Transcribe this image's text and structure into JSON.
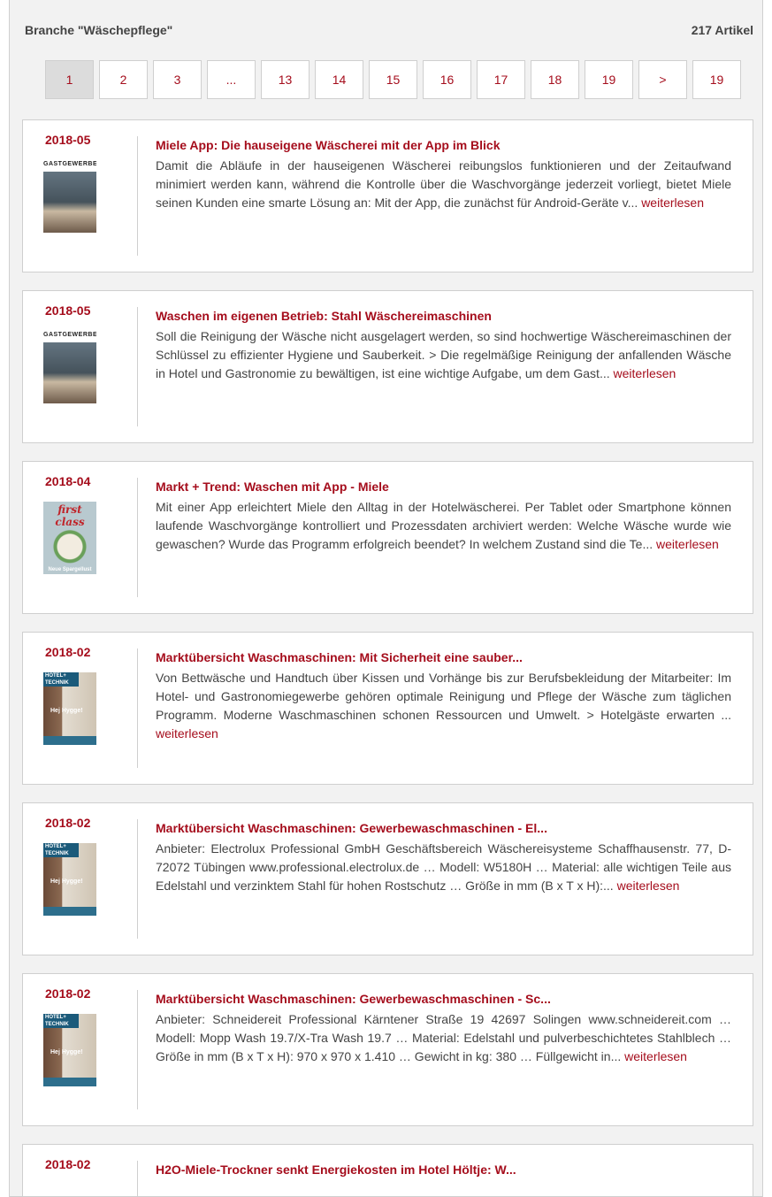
{
  "header": {
    "title": "Branche \"Wäschepflege\"",
    "count": "217 Artikel"
  },
  "pagination": {
    "pages": [
      "1",
      "2",
      "3",
      "...",
      "13",
      "14",
      "15",
      "16",
      "17",
      "18",
      "19",
      ">",
      "19"
    ],
    "active": "1"
  },
  "articles": [
    {
      "date": "2018-05",
      "cover": "Gastgewerbe Magazin cover",
      "title": "Miele App: Die hauseigene Wäscherei mit der App im Blick",
      "excerpt": "Damit die Abläufe in der hauseigenen Wäscherei reibungslos funktionieren und der Zeitaufwand minimiert werden kann, während die Kontrolle über die Waschvorgänge jederzeit vorliegt, bietet Miele seinen Kunden eine smarte Lösung an: Mit der App, die zunächst für Android-Geräte v...",
      "read_more": "weiterlesen"
    },
    {
      "date": "2018-05",
      "cover": "Gastgewerbe Magazin cover",
      "title": "Waschen im eigenen Betrieb: Stahl Wäschereimaschinen",
      "excerpt": "Soll die Reinigung der Wäsche nicht ausgelagert werden, so sind hochwertige Wäschereimaschinen der Schlüssel zu effizienter Hygiene und Sauberkeit. > Die regelmäßige Reinigung der anfallenden Wäsche in Hotel und Gastronomie zu bewältigen, ist eine wichtige Aufgabe, um dem Gast...",
      "read_more": "weiterlesen"
    },
    {
      "date": "2018-04",
      "cover": "first class magazine cover",
      "title": "Markt + Trend: Waschen mit App - Miele",
      "excerpt": "Mit einer App erleichtert Miele den Alltag in der Hotelwäscherei. Per Tablet oder Smartphone können laufende Waschvorgänge kontrolliert und Prozessdaten archiviert werden: Welche Wäsche wurde wie gewaschen? Wurde das Programm erfolgreich beendet? In welchem Zustand sind die Te...",
      "read_more": "weiterlesen"
    },
    {
      "date": "2018-02",
      "cover": "Hotel+Technik magazine cover",
      "title": "Marktübersicht Waschmaschinen: Mit Sicherheit eine sauber...",
      "excerpt": "Von Bettwäsche und Handtuch über Kissen und Vorhänge bis zur Berufsbekleidung der Mitarbeiter: Im Hotel- und Gastronomiegewerbe gehören optimale Reinigung und Pflege der Wäsche zum täglichen Programm. Moderne Waschmaschinen schonen Ressourcen und Umwelt. > Hotelgäste erwarten ...",
      "read_more": "weiterlesen"
    },
    {
      "date": "2018-02",
      "cover": "Hotel+Technik magazine cover",
      "title": "Marktübersicht Waschmaschinen: Gewerbewaschmaschinen - El...",
      "excerpt": "Anbieter: Electrolux Professional GmbH Geschäftsbereich Wäschereisysteme Schaffhausenstr. 77, D-72072 Tübingen www.professional.electrolux.de … Modell: W5180H … Material: alle wichtigen Teile aus Edelstahl und verzinktem Stahl für hohen Rostschutz … Größe in mm (B x T x H):...",
      "read_more": "weiterlesen"
    },
    {
      "date": "2018-02",
      "cover": "Hotel+Technik magazine cover",
      "title": "Marktübersicht Waschmaschinen: Gewerbewaschmaschinen - Sc...",
      "excerpt": "Anbieter: Schneidereit Professional Kärntener Straße 19 42697 Solingen www.schneidereit.com … Modell: Mopp Wash 19.7/X-Tra Wash 19.7 … Material: Edelstahl und pulverbeschichtetes Stahlblech … Größe in mm (B x T x H): 970 x 970 x 1.410 … Gewicht in kg: 380 … Füllgewicht in...",
      "read_more": "weiterlesen"
    },
    {
      "date": "2018-02",
      "cover": "",
      "title": "H2O-Miele-Trockner senkt Energiekosten im Hotel Höltje: W...",
      "excerpt": "",
      "read_more": ""
    }
  ],
  "covers": {
    "gastgewerbe": {
      "logo": "GASTGEWERBE",
      "logo_sub": "MAGAZIN"
    },
    "firstclass": {
      "logo": "first class",
      "sub": "Neue Spargellust"
    },
    "hoteltechnik": {
      "logo_line1": "HOTEL+",
      "logo_line2": "TECHNIK",
      "sub": "Hej Hygge!"
    }
  },
  "colors": {
    "accent": "#a50d1c",
    "panel_bg": "#f2f2f2",
    "border": "#cfcfcf",
    "active_page_bg": "#dcdcdc"
  }
}
